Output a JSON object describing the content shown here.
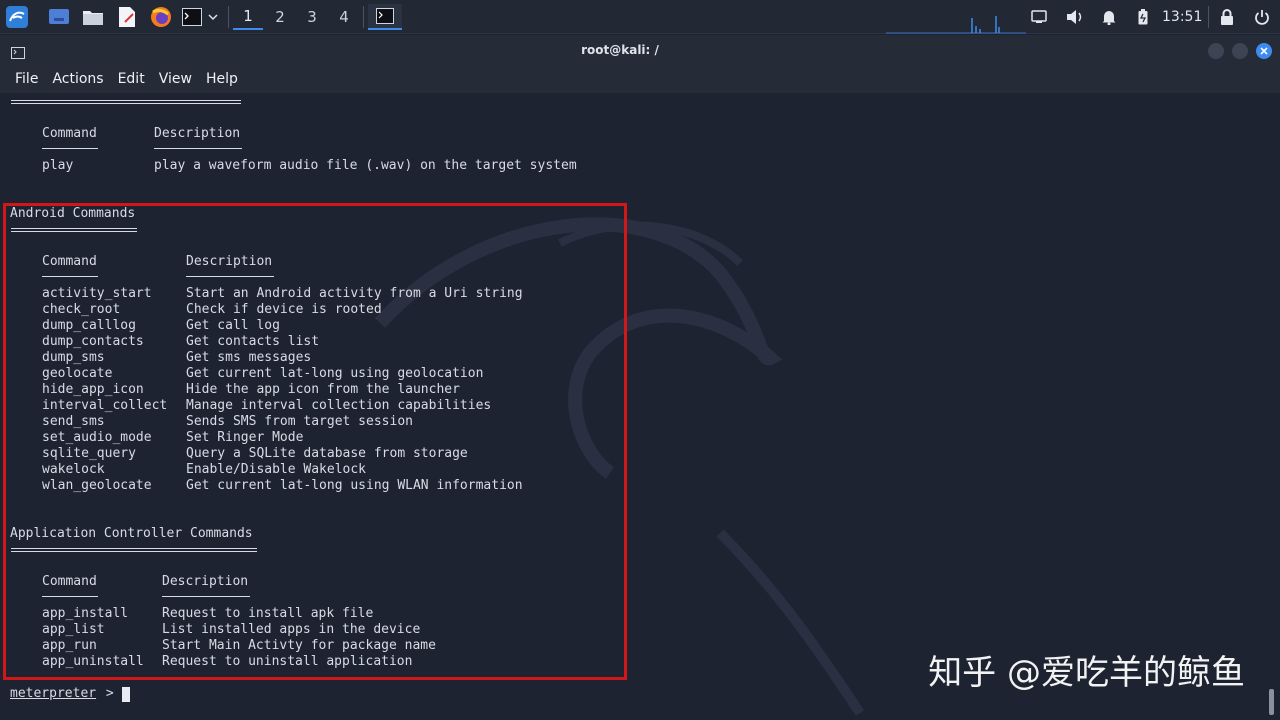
{
  "taskbar": {
    "workspaces": [
      "1",
      "2",
      "3",
      "4"
    ],
    "time": "13:51",
    "icons": [
      "kali-menu-icon",
      "desktop-icon",
      "files-icon",
      "editor-icon",
      "firefox-icon",
      "terminal-icon",
      "chevron-down-icon"
    ]
  },
  "window": {
    "title": "root@kali: /",
    "menu": [
      "File",
      "Actions",
      "Edit",
      "View",
      "Help"
    ]
  },
  "terminal": {
    "top_section": {
      "col_command": "Command",
      "col_description": "Description",
      "rows": [
        {
          "cmd": "play",
          "desc": "play a waveform audio file (.wav) on the target system"
        }
      ]
    },
    "android": {
      "title": "Android Commands",
      "col_command": "Command",
      "col_description": "Description",
      "rows": [
        {
          "cmd": "activity_start",
          "desc": "Start an Android activity from a Uri string"
        },
        {
          "cmd": "check_root",
          "desc": "Check if device is rooted"
        },
        {
          "cmd": "dump_calllog",
          "desc": "Get call log"
        },
        {
          "cmd": "dump_contacts",
          "desc": "Get contacts list"
        },
        {
          "cmd": "dump_sms",
          "desc": "Get sms messages"
        },
        {
          "cmd": "geolocate",
          "desc": "Get current lat-long using geolocation"
        },
        {
          "cmd": "hide_app_icon",
          "desc": "Hide the app icon from the launcher"
        },
        {
          "cmd": "interval_collect",
          "desc": "Manage interval collection capabilities"
        },
        {
          "cmd": "send_sms",
          "desc": "Sends SMS from target session"
        },
        {
          "cmd": "set_audio_mode",
          "desc": "Set Ringer Mode"
        },
        {
          "cmd": "sqlite_query",
          "desc": "Query a SQLite database from storage"
        },
        {
          "cmd": "wakelock",
          "desc": "Enable/Disable Wakelock"
        },
        {
          "cmd": "wlan_geolocate",
          "desc": "Get current lat-long using WLAN information"
        }
      ]
    },
    "appctl": {
      "title": "Application Controller Commands",
      "col_command": "Command",
      "col_description": "Description",
      "rows": [
        {
          "cmd": "app_install",
          "desc": "Request to install apk file"
        },
        {
          "cmd": "app_list",
          "desc": "List installed apps in the device"
        },
        {
          "cmd": "app_run",
          "desc": "Start Main Activty for package name"
        },
        {
          "cmd": "app_uninstall",
          "desc": "Request to uninstall application"
        }
      ]
    },
    "prompt": "meterpreter",
    "prompt_suffix": " >"
  },
  "watermark": "知乎 @爱吃羊的鲸鱼",
  "colors": {
    "highlight": "#d01818",
    "accent": "#3b8ced"
  }
}
